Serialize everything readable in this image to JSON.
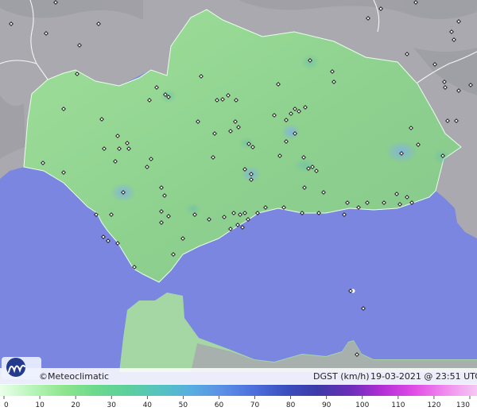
{
  "footer": {
    "brand": "©Meteoclimatic",
    "variable_label": "DGST (km/h)",
    "timestamp": "19-03-2021 @ 23:51 UTC"
  },
  "legend": {
    "ticks": [
      "0",
      "10",
      "20",
      "30",
      "40",
      "50",
      "60",
      "70",
      "80",
      "90",
      "100",
      "110",
      "120",
      "130"
    ],
    "gradient_colors": [
      "#eaffea",
      "#b9f5b9",
      "#8ee58e",
      "#6cd98c",
      "#5ccf9c",
      "#55c3c0",
      "#58aee0",
      "#5b8fe6",
      "#4d6fdc",
      "#3b4fbe",
      "#3d3aa8",
      "#6a2fb8",
      "#b12fd6",
      "#e04be6",
      "#f08cee",
      "#f6c7f4"
    ]
  },
  "colors": {
    "sea": "#7b86e0",
    "land_outside": "#a8a8ad",
    "andalucia": "#8fd48f",
    "morocco": "#a3d8a3",
    "border": "#ffffff"
  },
  "stations": [
    [
      70,
      3
    ],
    [
      14,
      30
    ],
    [
      58,
      42
    ],
    [
      124,
      30
    ],
    [
      100,
      57
    ],
    [
      80,
      137
    ],
    [
      97,
      93
    ],
    [
      128,
      150
    ],
    [
      148,
      171
    ],
    [
      131,
      187
    ],
    [
      150,
      187
    ],
    [
      160,
      180
    ],
    [
      162,
      187
    ],
    [
      145,
      203
    ],
    [
      80,
      217
    ],
    [
      54,
      205
    ],
    [
      185,
      210
    ],
    [
      190,
      200
    ],
    [
      155,
      242
    ],
    [
      121,
      270
    ],
    [
      140,
      270
    ],
    [
      130,
      298
    ],
    [
      136,
      303
    ],
    [
      148,
      306
    ],
    [
      169,
      336
    ],
    [
      203,
      236
    ],
    [
      207,
      246
    ],
    [
      203,
      266
    ],
    [
      203,
      280
    ],
    [
      212,
      272
    ],
    [
      218,
      320
    ],
    [
      230,
      300
    ],
    [
      197,
      110
    ],
    [
      208,
      119
    ],
    [
      188,
      126
    ],
    [
      212,
      122
    ],
    [
      253,
      96
    ],
    [
      280,
      125
    ],
    [
      273,
      126
    ],
    [
      287,
      120
    ],
    [
      297,
      126
    ],
    [
      249,
      153
    ],
    [
      270,
      168
    ],
    [
      290,
      165
    ],
    [
      296,
      153
    ],
    [
      300,
      160
    ],
    [
      313,
      181
    ],
    [
      318,
      185
    ],
    [
      308,
      213
    ],
    [
      316,
      219
    ],
    [
      316,
      226
    ],
    [
      268,
      198
    ],
    [
      245,
      270
    ],
    [
      263,
      276
    ],
    [
      282,
      273
    ],
    [
      294,
      268
    ],
    [
      299,
      283
    ],
    [
      302,
      270
    ],
    [
      308,
      268
    ],
    [
      312,
      276
    ],
    [
      290,
      288
    ],
    [
      305,
      286
    ],
    [
      324,
      268
    ],
    [
      334,
      261
    ],
    [
      357,
      261
    ],
    [
      380,
      268
    ],
    [
      401,
      268
    ],
    [
      345,
      145
    ],
    [
      360,
      151
    ],
    [
      366,
      143
    ],
    [
      371,
      137
    ],
    [
      376,
      140
    ],
    [
      384,
      135
    ],
    [
      390,
      76
    ],
    [
      418,
      90
    ],
    [
      420,
      103
    ],
    [
      350,
      106
    ],
    [
      352,
      196
    ],
    [
      360,
      178
    ],
    [
      382,
      198
    ],
    [
      388,
      212
    ],
    [
      393,
      210
    ],
    [
      398,
      215
    ],
    [
      383,
      236
    ],
    [
      371,
      168
    ],
    [
      407,
      242
    ],
    [
      437,
      255
    ],
    [
      433,
      270
    ],
    [
      451,
      261
    ],
    [
      462,
      255
    ],
    [
      483,
      255
    ],
    [
      499,
      244
    ],
    [
      503,
      257
    ],
    [
      512,
      248
    ],
    [
      518,
      255
    ],
    [
      505,
      193
    ],
    [
      526,
      182
    ],
    [
      517,
      161
    ],
    [
      557,
      196
    ],
    [
      559,
      103
    ],
    [
      560,
      110
    ],
    [
      563,
      152
    ],
    [
      574,
      152
    ],
    [
      568,
      40
    ],
    [
      577,
      27
    ],
    [
      523,
      3
    ],
    [
      571,
      50
    ],
    [
      463,
      23
    ],
    [
      479,
      11
    ],
    [
      512,
      68
    ],
    [
      547,
      81
    ],
    [
      577,
      114
    ],
    [
      592,
      107
    ],
    [
      457,
      388
    ],
    [
      441,
      366
    ],
    [
      449,
      446
    ]
  ]
}
